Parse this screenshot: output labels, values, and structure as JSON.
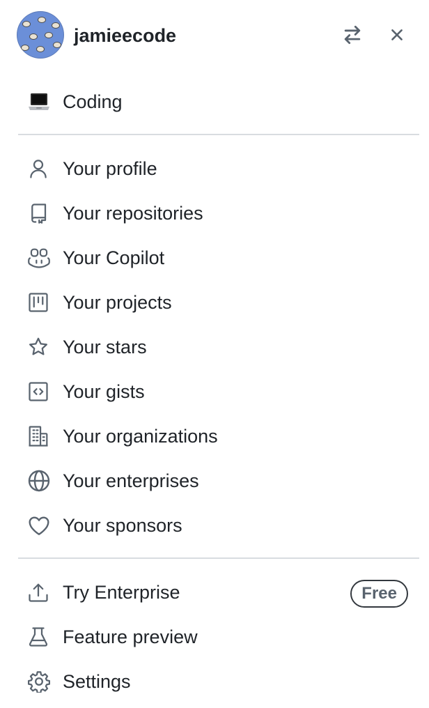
{
  "header": {
    "username": "jamieecode",
    "avatar_icon": "avatar-pattern-icon",
    "switch_icon": "switch-arrows-icon",
    "close_icon": "close-icon"
  },
  "status": {
    "emoji_icon": "laptop-icon",
    "label": "Coding"
  },
  "menu": {
    "items": [
      {
        "label": "Your profile",
        "icon": "person-icon"
      },
      {
        "label": "Your repositories",
        "icon": "repo-icon"
      },
      {
        "label": "Your Copilot",
        "icon": "copilot-icon"
      },
      {
        "label": "Your projects",
        "icon": "project-icon"
      },
      {
        "label": "Your stars",
        "icon": "star-icon"
      },
      {
        "label": "Your gists",
        "icon": "code-square-icon"
      },
      {
        "label": "Your organizations",
        "icon": "organization-icon"
      },
      {
        "label": "Your enterprises",
        "icon": "globe-icon"
      },
      {
        "label": "Your sponsors",
        "icon": "heart-icon"
      }
    ]
  },
  "footer": {
    "items": [
      {
        "label": "Try Enterprise",
        "icon": "upload-icon",
        "badge": "Free"
      },
      {
        "label": "Feature preview",
        "icon": "beaker-icon"
      },
      {
        "label": "Settings",
        "icon": "gear-icon"
      }
    ]
  },
  "colors": {
    "text": "#1f2328",
    "icon": "#59636e",
    "divider": "#d8dce0",
    "avatar_bg": "#6b8fd8"
  }
}
